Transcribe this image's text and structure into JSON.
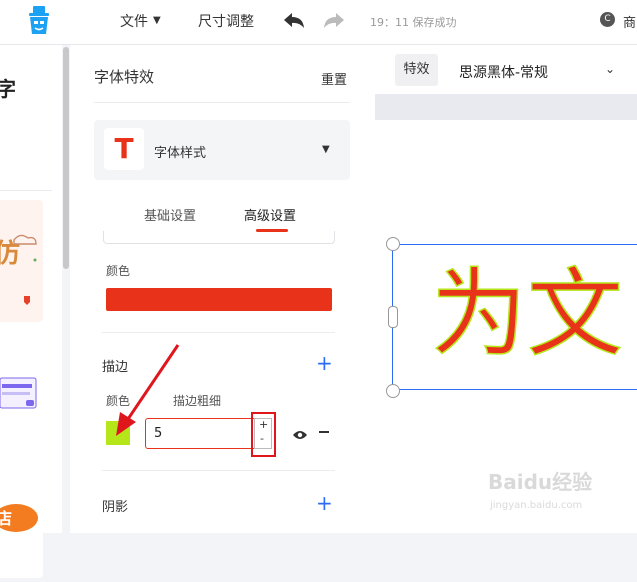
{
  "topbar": {
    "menu_file": "文件",
    "menu_size": "尺寸调整",
    "save_status": "19：11 保存成功",
    "right_initial": "C",
    "right_text": "商"
  },
  "left": {
    "partial_char": "字"
  },
  "panel": {
    "title": "字体特效",
    "reset": "重置",
    "style_card": {
      "icon_letter": "T",
      "label": "字体样式"
    },
    "tabs": [
      "基础设置",
      "高级设置"
    ],
    "active_tab": 1,
    "fill": {
      "label": "颜色",
      "color": "#e8321a"
    },
    "stroke": {
      "title": "描边",
      "color_label": "颜色",
      "width_label": "描边粗细",
      "color": "#b4e61a",
      "width_value": "5",
      "stepper_up": "+",
      "stepper_down": "-"
    },
    "shadow": {
      "title": "阴影"
    }
  },
  "toolbar": {
    "effect_label": "特效",
    "font_name": "思源黑体-常规"
  },
  "canvas": {
    "text": "为文",
    "text_color": "#e8321a",
    "stroke_color": "#b4e61a",
    "selection_color": "#2b6cf2"
  },
  "watermark": {
    "line1": "Baidu经验",
    "line2": "jingyan.baidu.com"
  },
  "annotation_color": "#e0161d"
}
